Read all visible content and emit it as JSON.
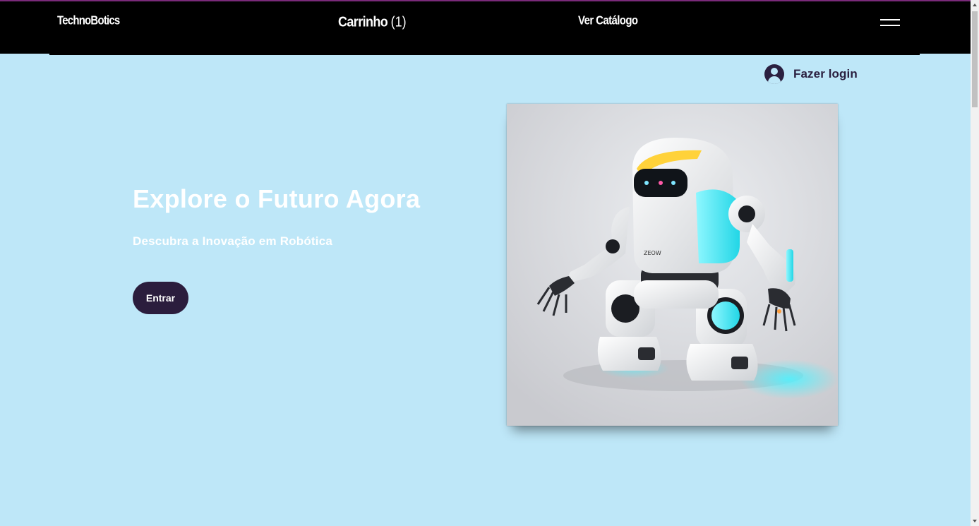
{
  "header": {
    "logo": "TechnoBotics",
    "cart_label": "Carrinho",
    "cart_count": "(1)",
    "catalog_label": "Ver Catálogo",
    "menu_icon": "hamburger-menu-icon"
  },
  "account": {
    "login_label": "Fazer login",
    "icon": "user-avatar-icon"
  },
  "hero": {
    "title": "Explore o Futuro Agora",
    "subtitle": "Descubra a Inovação em Robótica",
    "button_label": "Entrar",
    "image_label": "ZEOW"
  },
  "colors": {
    "background": "#bee7f8",
    "header": "#000000",
    "button": "#2b1d3d",
    "accent_cyan": "#3ee6f0",
    "accent_yellow": "#ffd23a"
  }
}
